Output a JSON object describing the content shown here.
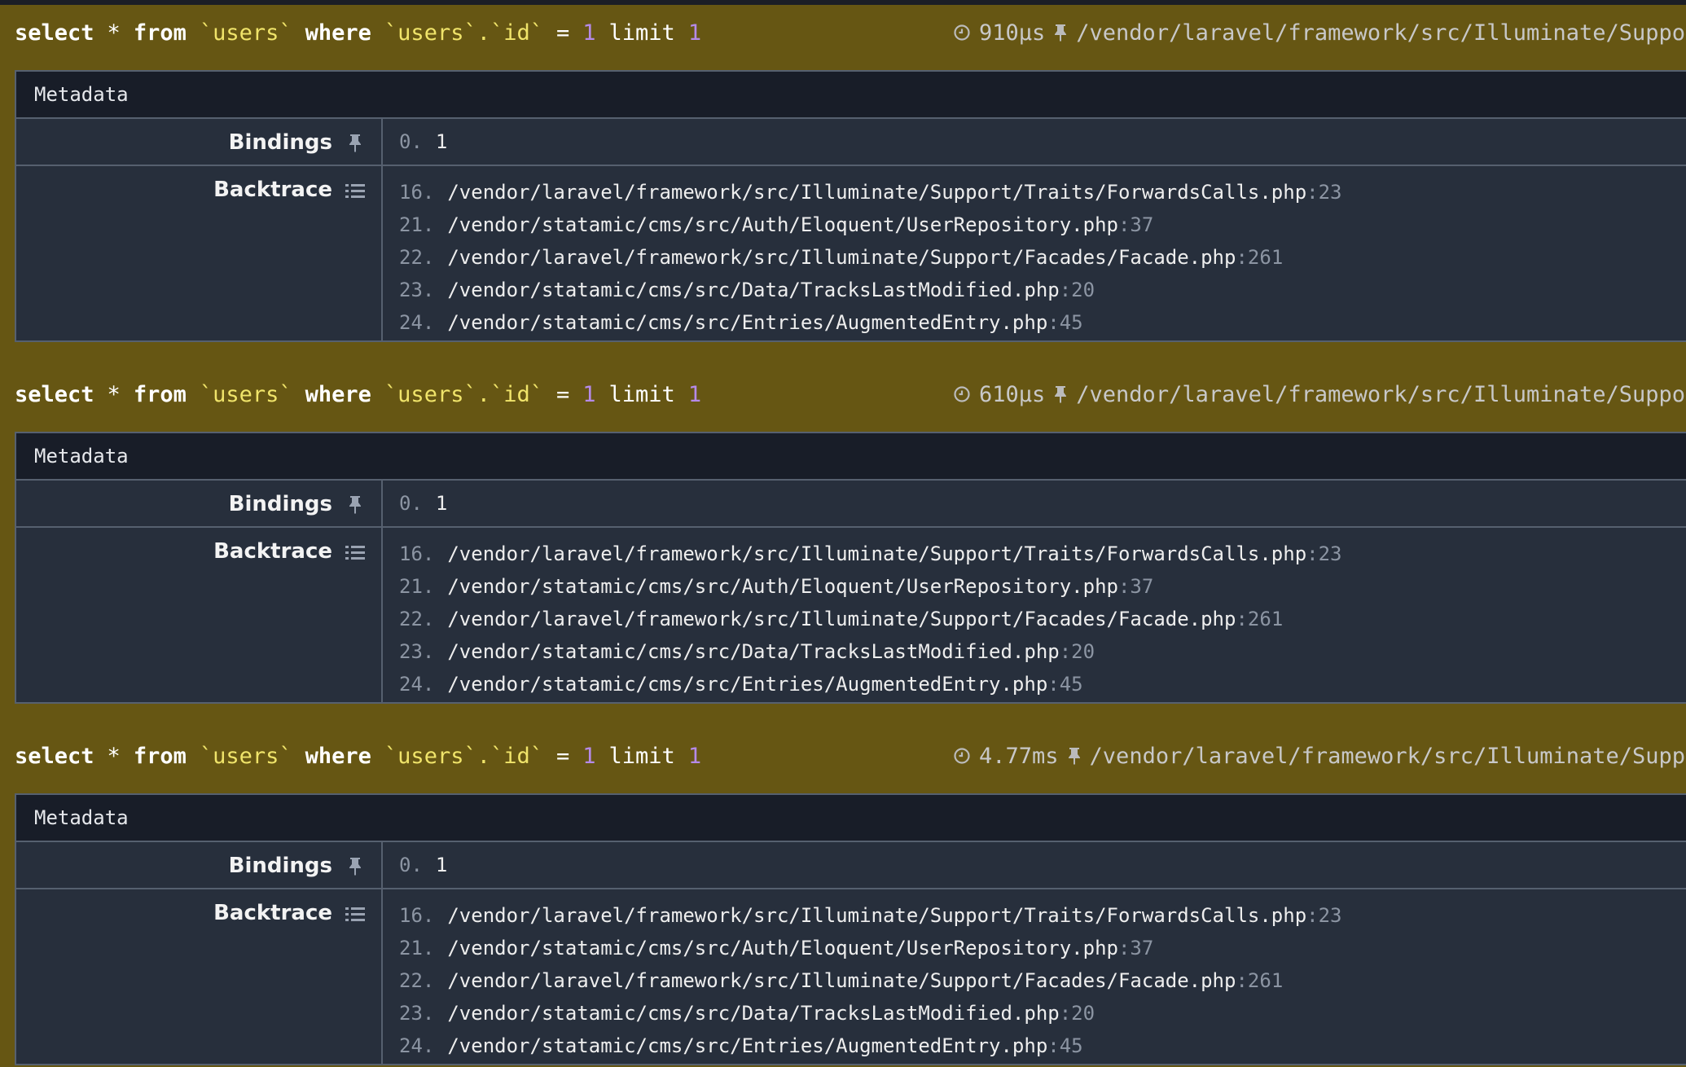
{
  "queries": [
    {
      "sql": {
        "select": "select",
        "star": "*",
        "from": "from",
        "table": "`users`",
        "where": "where",
        "column": "`users`.`id`",
        "eq": "=",
        "id_value": "1",
        "limit": "limit",
        "limit_value": "1"
      },
      "duration": "910µs",
      "source_path": "/vendor/laravel/framework/src/Illuminate/Support/",
      "metadata_label": "Metadata",
      "bindings_label": "Bindings",
      "bindings": [
        {
          "index": "0.",
          "value": "1"
        }
      ],
      "backtrace_label": "Backtrace",
      "backtrace": [
        {
          "index": "16.",
          "path": "/vendor/laravel/framework/src/Illuminate/Support/Traits/ForwardsCalls.php",
          "line": ":23"
        },
        {
          "index": "21.",
          "path": "/vendor/statamic/cms/src/Auth/Eloquent/UserRepository.php",
          "line": ":37"
        },
        {
          "index": "22.",
          "path": "/vendor/laravel/framework/src/Illuminate/Support/Facades/Facade.php",
          "line": ":261"
        },
        {
          "index": "23.",
          "path": "/vendor/statamic/cms/src/Data/TracksLastModified.php",
          "line": ":20"
        },
        {
          "index": "24.",
          "path": "/vendor/statamic/cms/src/Entries/AugmentedEntry.php",
          "line": ":45"
        }
      ]
    },
    {
      "sql": {
        "select": "select",
        "star": "*",
        "from": "from",
        "table": "`users`",
        "where": "where",
        "column": "`users`.`id`",
        "eq": "=",
        "id_value": "1",
        "limit": "limit",
        "limit_value": "1"
      },
      "duration": "610µs",
      "source_path": "/vendor/laravel/framework/src/Illuminate/Support/",
      "metadata_label": "Metadata",
      "bindings_label": "Bindings",
      "bindings": [
        {
          "index": "0.",
          "value": "1"
        }
      ],
      "backtrace_label": "Backtrace",
      "backtrace": [
        {
          "index": "16.",
          "path": "/vendor/laravel/framework/src/Illuminate/Support/Traits/ForwardsCalls.php",
          "line": ":23"
        },
        {
          "index": "21.",
          "path": "/vendor/statamic/cms/src/Auth/Eloquent/UserRepository.php",
          "line": ":37"
        },
        {
          "index": "22.",
          "path": "/vendor/laravel/framework/src/Illuminate/Support/Facades/Facade.php",
          "line": ":261"
        },
        {
          "index": "23.",
          "path": "/vendor/statamic/cms/src/Data/TracksLastModified.php",
          "line": ":20"
        },
        {
          "index": "24.",
          "path": "/vendor/statamic/cms/src/Entries/AugmentedEntry.php",
          "line": ":45"
        }
      ]
    },
    {
      "sql": {
        "select": "select",
        "star": "*",
        "from": "from",
        "table": "`users`",
        "where": "where",
        "column": "`users`.`id`",
        "eq": "=",
        "id_value": "1",
        "limit": "limit",
        "limit_value": "1"
      },
      "duration": "4.77ms",
      "source_path": "/vendor/laravel/framework/src/Illuminate/Support/",
      "metadata_label": "Metadata",
      "bindings_label": "Bindings",
      "bindings": [
        {
          "index": "0.",
          "value": "1"
        }
      ],
      "backtrace_label": "Backtrace",
      "backtrace": [
        {
          "index": "16.",
          "path": "/vendor/laravel/framework/src/Illuminate/Support/Traits/ForwardsCalls.php",
          "line": ":23"
        },
        {
          "index": "21.",
          "path": "/vendor/statamic/cms/src/Auth/Eloquent/UserRepository.php",
          "line": ":37"
        },
        {
          "index": "22.",
          "path": "/vendor/laravel/framework/src/Illuminate/Support/Facades/Facade.php",
          "line": ":261"
        },
        {
          "index": "23.",
          "path": "/vendor/statamic/cms/src/Data/TracksLastModified.php",
          "line": ":20"
        },
        {
          "index": "24.",
          "path": "/vendor/statamic/cms/src/Entries/AugmentedEntry.php",
          "line": ":45"
        }
      ]
    }
  ],
  "icons": {
    "duration": "clock-icon",
    "source": "pin-icon",
    "bindings": "pin-icon",
    "backtrace": "list-icon"
  },
  "colors": {
    "background": "#665613",
    "panel": "#272f3c",
    "panel_header": "#181d28",
    "string": "#f0e46a",
    "number": "#b58ae8",
    "muted": "#8c95a3"
  }
}
